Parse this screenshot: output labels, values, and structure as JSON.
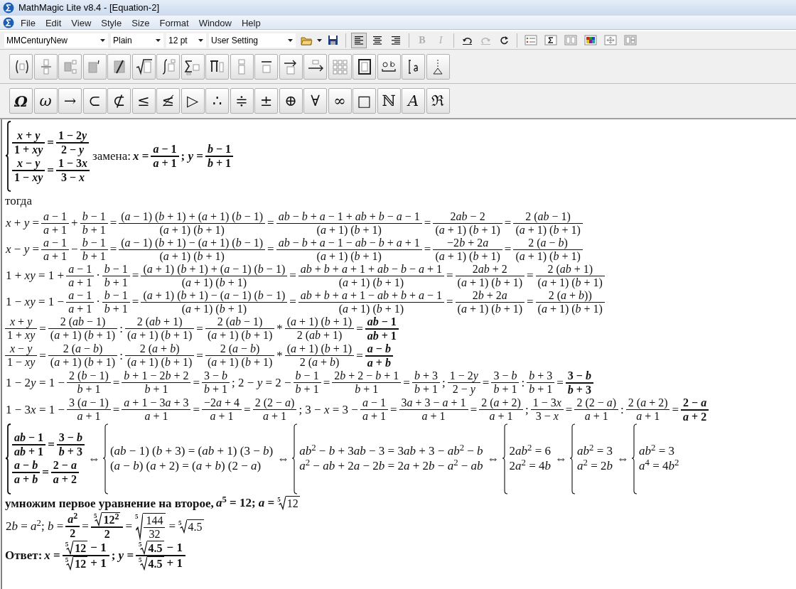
{
  "window": {
    "title": "MathMagic Lite v8.4 - [Equation-2]"
  },
  "menu": [
    "File",
    "Edit",
    "View",
    "Style",
    "Size",
    "Format",
    "Window",
    "Help"
  ],
  "toolbar": {
    "font": "MMCenturyNew",
    "style": "Plain",
    "size": "12 pt",
    "spacing": "User Setting",
    "align": [
      {
        "kind": "left",
        "selected": true
      },
      {
        "kind": "center",
        "selected": false
      },
      {
        "kind": "right",
        "selected": false
      }
    ],
    "format": [
      {
        "label": "B",
        "disabled": true
      },
      {
        "label": "I",
        "disabled": true
      }
    ],
    "history": [
      {
        "kind": "undo",
        "disabled": false
      },
      {
        "kind": "redo",
        "disabled": true
      },
      {
        "kind": "refresh",
        "disabled": false
      }
    ]
  },
  "symbols": [
    "Ω",
    "ω",
    "→",
    "⊂",
    "⊄",
    "≤",
    "≰",
    "▷",
    "∴",
    "≑",
    "±",
    "⊕",
    "∀",
    "∞",
    "□",
    "ℕ",
    "A",
    "ℜ"
  ],
  "document": {
    "lines": [
      [
        {
          "kind": "system",
          "bold": true,
          "rows": [
            [
              {
                "kind": "fraction",
                "num": "x + y",
                "den": "1 + xy"
              },
              {
                "kind": "math",
                "text": "="
              },
              {
                "kind": "fraction",
                "num": "1 − 2y",
                "den": "2 − y"
              }
            ],
            [
              {
                "kind": "fraction",
                "num": "x − y",
                "den": "1 − xy"
              },
              {
                "kind": "math",
                "text": "="
              },
              {
                "kind": "fraction",
                "num": "1 − 3x",
                "den": "3 − x"
              }
            ]
          ]
        },
        {
          "kind": "words",
          "text": "замена:"
        },
        {
          "kind": "math",
          "bold": true,
          "text": "x ="
        },
        {
          "kind": "fraction",
          "bold": true,
          "num": "a − 1",
          "den": "a + 1"
        },
        {
          "kind": "math",
          "bold": true,
          "text": "; y ="
        },
        {
          "kind": "fraction",
          "bold": true,
          "num": "b − 1",
          "den": "b + 1"
        }
      ],
      [
        {
          "kind": "words",
          "text": "тогда"
        }
      ],
      [
        {
          "kind": "math",
          "text": "x + y ="
        },
        {
          "kind": "fraction",
          "num": "a − 1",
          "den": "a + 1"
        },
        {
          "kind": "math",
          "text": "+"
        },
        {
          "kind": "fraction",
          "num": "b − 1",
          "den": "b + 1"
        },
        {
          "kind": "math",
          "text": "="
        },
        {
          "kind": "fraction",
          "num": "(a − 1) (b + 1) + (a + 1) (b − 1)",
          "den": "(a + 1) (b + 1)"
        },
        {
          "kind": "math",
          "text": "="
        },
        {
          "kind": "fraction",
          "num": "ab − b + a − 1 + ab + b − a − 1",
          "den": "(a + 1) (b + 1)"
        },
        {
          "kind": "math",
          "text": "="
        },
        {
          "kind": "fraction",
          "num": "2ab − 2",
          "den": "(a + 1) (b + 1)"
        },
        {
          "kind": "math",
          "text": "="
        },
        {
          "kind": "fraction",
          "num": "2 (ab − 1)",
          "den": "(a + 1) (b + 1)"
        }
      ],
      [
        {
          "kind": "math",
          "text": "x − y ="
        },
        {
          "kind": "fraction",
          "num": "a − 1",
          "den": "a + 1"
        },
        {
          "kind": "math",
          "text": "−"
        },
        {
          "kind": "fraction",
          "num": "b − 1",
          "den": "b + 1"
        },
        {
          "kind": "math",
          "text": "="
        },
        {
          "kind": "fraction",
          "num": "(a − 1) (b + 1) − (a + 1) (b − 1)",
          "den": "(a + 1) (b + 1)"
        },
        {
          "kind": "math",
          "text": "="
        },
        {
          "kind": "fraction",
          "num": "ab − b + a − 1 − ab − b + a + 1",
          "den": "(a + 1) (b + 1)"
        },
        {
          "kind": "math",
          "text": "="
        },
        {
          "kind": "fraction",
          "num": "−2b + 2a",
          "den": "(a + 1) (b + 1)"
        },
        {
          "kind": "math",
          "text": "="
        },
        {
          "kind": "fraction",
          "num": "2 (a − b)",
          "den": "(a + 1) (b + 1)"
        }
      ],
      [
        {
          "kind": "math",
          "text": "1 + xy = 1 +"
        },
        {
          "kind": "fraction",
          "num": "a − 1",
          "den": "a + 1"
        },
        {
          "kind": "math",
          "text": "·"
        },
        {
          "kind": "fraction",
          "num": "b − 1",
          "den": "b + 1"
        },
        {
          "kind": "math",
          "text": "="
        },
        {
          "kind": "fraction",
          "num": "(a + 1) (b + 1) + (a − 1) (b − 1)",
          "den": "(a + 1) (b + 1)"
        },
        {
          "kind": "math",
          "text": "="
        },
        {
          "kind": "fraction",
          "num": "ab + b + a + 1 + ab − b − a + 1",
          "den": "(a + 1) (b + 1)"
        },
        {
          "kind": "math",
          "text": "="
        },
        {
          "kind": "fraction",
          "num": "2ab + 2",
          "den": "(a + 1) (b + 1)"
        },
        {
          "kind": "math",
          "text": "="
        },
        {
          "kind": "fraction",
          "num": "2 (ab + 1)",
          "den": "(a + 1) (b + 1)"
        }
      ],
      [
        {
          "kind": "math",
          "text": "1 − xy = 1 −"
        },
        {
          "kind": "fraction",
          "num": "a − 1",
          "den": "a + 1"
        },
        {
          "kind": "math",
          "text": "·"
        },
        {
          "kind": "fraction",
          "num": "b − 1",
          "den": "b + 1"
        },
        {
          "kind": "math",
          "text": "="
        },
        {
          "kind": "fraction",
          "num": "(a + 1) (b + 1) − (a − 1) (b − 1)",
          "den": "(a + 1) (b + 1)"
        },
        {
          "kind": "math",
          "text": "="
        },
        {
          "kind": "fraction",
          "num": "ab + b + a + 1 − ab + b + a − 1",
          "den": "(a + 1) (b + 1)"
        },
        {
          "kind": "math",
          "text": "="
        },
        {
          "kind": "fraction",
          "num": "2b + 2a",
          "den": "(a + 1) (b + 1)"
        },
        {
          "kind": "math",
          "text": "="
        },
        {
          "kind": "fraction",
          "num": "2 (a + b))",
          "den": "(a + 1) (b + 1)"
        }
      ],
      [
        {
          "kind": "fraction",
          "num": "x + y",
          "den": "1 + xy"
        },
        {
          "kind": "math",
          "text": "="
        },
        {
          "kind": "fraction",
          "num": "2 (ab − 1)",
          "den": "(a + 1) (b + 1)"
        },
        {
          "kind": "math",
          "text": ":"
        },
        {
          "kind": "fraction",
          "num": "2 (ab + 1)",
          "den": "(a + 1) (b + 1)"
        },
        {
          "kind": "math",
          "text": "="
        },
        {
          "kind": "fraction",
          "num": "2 (ab − 1)",
          "den": "(a + 1) (b + 1)"
        },
        {
          "kind": "math",
          "text": "*"
        },
        {
          "kind": "fraction",
          "num": "(a + 1) (b + 1)",
          "den": "2 (ab + 1)"
        },
        {
          "kind": "math",
          "text": "="
        },
        {
          "kind": "fraction",
          "bold": true,
          "num": "ab − 1",
          "den": "ab + 1"
        }
      ],
      [
        {
          "kind": "fraction",
          "num": "x − y",
          "den": "1 − xy"
        },
        {
          "kind": "math",
          "text": "="
        },
        {
          "kind": "fraction",
          "num": "2 (a − b)",
          "den": "(a + 1) (b + 1)"
        },
        {
          "kind": "math",
          "text": ":"
        },
        {
          "kind": "fraction",
          "num": "2 (a + b)",
          "den": "(a + 1) (b + 1)"
        },
        {
          "kind": "math",
          "text": "="
        },
        {
          "kind": "fraction",
          "num": "2 (a − b)",
          "den": "(a + 1) (b + 1)"
        },
        {
          "kind": "math",
          "text": "*"
        },
        {
          "kind": "fraction",
          "num": "(a + 1) (b + 1)",
          "den": "2 (a + b)"
        },
        {
          "kind": "math",
          "text": "="
        },
        {
          "kind": "fraction",
          "bold": true,
          "num": "a − b",
          "den": "a + b"
        }
      ],
      [
        {
          "kind": "math",
          "text": "1 − 2y = 1 −"
        },
        {
          "kind": "fraction",
          "num": "2 (b − 1)",
          "den": "b + 1"
        },
        {
          "kind": "math",
          "text": "="
        },
        {
          "kind": "fraction",
          "num": "b + 1 − 2b + 2",
          "den": "b + 1"
        },
        {
          "kind": "math",
          "text": "="
        },
        {
          "kind": "fraction",
          "num": "3 − b",
          "den": "b + 1"
        },
        {
          "kind": "math",
          "text": "; 2 − y = 2 −"
        },
        {
          "kind": "fraction",
          "num": "b − 1",
          "den": "b + 1"
        },
        {
          "kind": "math",
          "text": "="
        },
        {
          "kind": "fraction",
          "num": "2b + 2 − b + 1",
          "den": "b + 1"
        },
        {
          "kind": "math",
          "text": "="
        },
        {
          "kind": "fraction",
          "num": "b + 3",
          "den": "b + 1"
        },
        {
          "kind": "math",
          "text": ";"
        },
        {
          "kind": "fraction",
          "num": "1 − 2y",
          "den": "2 − y"
        },
        {
          "kind": "math",
          "text": "="
        },
        {
          "kind": "fraction",
          "num": "3 − b",
          "den": "b + 1"
        },
        {
          "kind": "math",
          "text": ":"
        },
        {
          "kind": "fraction",
          "num": "b + 3",
          "den": "b + 1"
        },
        {
          "kind": "math",
          "text": "="
        },
        {
          "kind": "fraction",
          "bold": true,
          "num": "3 − b",
          "den": "b + 3"
        }
      ],
      [
        {
          "kind": "math",
          "text": "1 − 3x = 1 −"
        },
        {
          "kind": "fraction",
          "num": "3 (a − 1)",
          "den": "a + 1"
        },
        {
          "kind": "math",
          "text": "="
        },
        {
          "kind": "fraction",
          "num": "a + 1 − 3a + 3",
          "den": "a + 1"
        },
        {
          "kind": "math",
          "text": "="
        },
        {
          "kind": "fraction",
          "num": "−2a + 4",
          "den": "a + 1"
        },
        {
          "kind": "math",
          "text": "="
        },
        {
          "kind": "fraction",
          "num": "2 (2 − a)",
          "den": "a + 1"
        },
        {
          "kind": "math",
          "text": "; 3 − x = 3 −"
        },
        {
          "kind": "fraction",
          "num": "a − 1",
          "den": "a + 1"
        },
        {
          "kind": "math",
          "text": "="
        },
        {
          "kind": "fraction",
          "num": "3a + 3 − a + 1",
          "den": "a + 1"
        },
        {
          "kind": "math",
          "text": "="
        },
        {
          "kind": "fraction",
          "num": "2 (a + 2)",
          "den": "a + 1"
        },
        {
          "kind": "math",
          "text": ";"
        },
        {
          "kind": "fraction",
          "num": "1 − 3x",
          "den": "3 − x"
        },
        {
          "kind": "math",
          "text": "="
        },
        {
          "kind": "fraction",
          "num": "2 (2 − a)",
          "den": "a + 1"
        },
        {
          "kind": "math",
          "text": ":"
        },
        {
          "kind": "fraction",
          "num": "2 (a + 2)",
          "den": "a + 1"
        },
        {
          "kind": "math",
          "text": "="
        },
        {
          "kind": "fraction",
          "bold": true,
          "num": "2 − a",
          "den": "a + 2"
        }
      ],
      [
        {
          "kind": "system",
          "bold": true,
          "rows": [
            [
              {
                "kind": "fraction",
                "num": "ab − 1",
                "den": "ab + 1"
              },
              {
                "kind": "math",
                "text": "="
              },
              {
                "kind": "fraction",
                "num": "3 − b",
                "den": "b + 3"
              }
            ],
            [
              {
                "kind": "fraction",
                "num": "a − b",
                "den": "a + b"
              },
              {
                "kind": "math",
                "text": "="
              },
              {
                "kind": "fraction",
                "num": "2 − a",
                "den": "a + 2"
              }
            ]
          ]
        },
        {
          "kind": "math",
          "text": "⇔"
        },
        {
          "kind": "system",
          "rows": [
            [
              {
                "kind": "math",
                "text": "(ab − 1) (b + 3) = (ab + 1) (3 − b)"
              }
            ],
            [
              {
                "kind": "math",
                "text": "(a − b) (a + 2) = (a + b) (2 − a)"
              }
            ]
          ]
        },
        {
          "kind": "math",
          "text": "⇔"
        },
        {
          "kind": "system",
          "rows": [
            [
              {
                "kind": "math",
                "text": "ab$^{2}$ − b + 3ab − 3 = 3ab + 3 − ab$^{2}$ − b"
              }
            ],
            [
              {
                "kind": "math",
                "text": "a$^{2}$ − ab + 2a − 2b = 2a + 2b − a$^{2}$ − ab"
              }
            ]
          ]
        },
        {
          "kind": "math",
          "text": "⇔"
        },
        {
          "kind": "system",
          "rows": [
            [
              {
                "kind": "math",
                "text": "2ab$^{2}$ = 6"
              }
            ],
            [
              {
                "kind": "math",
                "text": "2a$^{2}$ = 4b"
              }
            ]
          ]
        },
        {
          "kind": "math",
          "text": "⇔"
        },
        {
          "kind": "system",
          "rows": [
            [
              {
                "kind": "math",
                "text": "ab$^{2}$ = 3"
              }
            ],
            [
              {
                "kind": "math",
                "text": "a$^{2}$ = 2b"
              }
            ]
          ]
        },
        {
          "kind": "math",
          "text": "⇔"
        },
        {
          "kind": "system",
          "rows": [
            [
              {
                "kind": "math",
                "text": "ab$^{2}$ = 3"
              }
            ],
            [
              {
                "kind": "math",
                "text": "a$^{4}$ = 4b$^{2}$"
              }
            ]
          ]
        }
      ],
      [
        {
          "kind": "words",
          "bold": true,
          "text": "умножим первое уравнение на второе,"
        },
        {
          "kind": "math",
          "bold": true,
          "text": "a$^{5}$ = 12; a ="
        },
        {
          "kind": "root",
          "index": "5",
          "radicand": "12"
        }
      ],
      [
        {
          "kind": "math",
          "text": "2b = a$^{2}$; b ="
        },
        {
          "kind": "fraction",
          "bold": true,
          "num": "a$^{2}$",
          "den": "2"
        },
        {
          "kind": "math",
          "text": "="
        },
        {
          "kind": "fraction",
          "bold": true,
          "num": [
            {
              "kind": "root",
              "index": "5",
              "radicand": "12$^{2}$"
            }
          ],
          "den": "2"
        },
        {
          "kind": "math",
          "text": "="
        },
        {
          "kind": "root",
          "index": "5",
          "radicand": [
            {
              "kind": "fraction",
              "num": "144",
              "den": "32"
            }
          ]
        },
        {
          "kind": "math",
          "text": "="
        },
        {
          "kind": "root",
          "index": "5",
          "radicand": "4.5"
        }
      ],
      [
        {
          "kind": "words",
          "bold": true,
          "text": "Ответ:"
        },
        {
          "kind": "math",
          "bold": true,
          "text": "x ="
        },
        {
          "kind": "fraction",
          "bold": true,
          "num": [
            {
              "kind": "root",
              "index": "5",
              "radicand": "12"
            },
            {
              "kind": "math",
              "text": "− 1"
            }
          ],
          "den": [
            {
              "kind": "root",
              "index": "5",
              "radicand": "12"
            },
            {
              "kind": "math",
              "text": "+ 1"
            }
          ]
        },
        {
          "kind": "math",
          "bold": true,
          "text": "; y ="
        },
        {
          "kind": "fraction",
          "bold": true,
          "num": [
            {
              "kind": "root",
              "index": "5",
              "radicand": "4.5"
            },
            {
              "kind": "math",
              "text": "− 1"
            }
          ],
          "den": [
            {
              "kind": "root",
              "index": "5",
              "radicand": "4.5"
            },
            {
              "kind": "math",
              "text": "+ 1"
            }
          ]
        }
      ]
    ]
  }
}
